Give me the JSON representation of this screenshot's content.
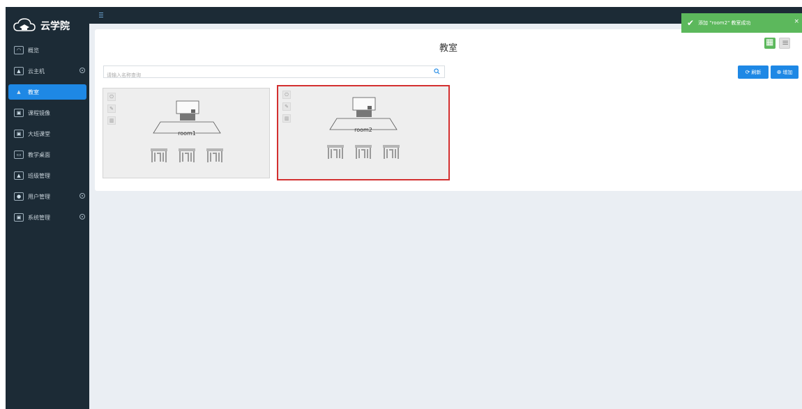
{
  "app": {
    "name": "云学院"
  },
  "sidebar": {
    "items": [
      {
        "label": "概览",
        "icon": "dashboard-icon",
        "glyph": "◠",
        "expandable": false,
        "active": false
      },
      {
        "label": "云主机",
        "icon": "user-icon",
        "glyph": "▲",
        "expandable": true,
        "active": false
      },
      {
        "label": "教室",
        "icon": "classroom-icon",
        "glyph": "▲",
        "expandable": false,
        "active": true
      },
      {
        "label": "课程镜像",
        "icon": "image-icon",
        "glyph": "▣",
        "expandable": false,
        "active": false
      },
      {
        "label": "大班课堂",
        "icon": "lecture-icon",
        "glyph": "▣",
        "expandable": false,
        "active": false
      },
      {
        "label": "教学桌面",
        "icon": "desktop-icon",
        "glyph": "▭",
        "expandable": false,
        "active": false
      },
      {
        "label": "班级管理",
        "icon": "class-management-icon",
        "glyph": "▲",
        "expandable": false,
        "active": false
      },
      {
        "label": "用户管理",
        "icon": "user-management-icon",
        "glyph": "●",
        "expandable": true,
        "active": false
      },
      {
        "label": "系统管理",
        "icon": "system-icon",
        "glyph": "▣",
        "expandable": true,
        "active": false
      }
    ]
  },
  "page": {
    "title": "教室",
    "search_placeholder": "请输入名称查询",
    "refresh_label": "刷新",
    "add_label": "增加"
  },
  "rooms": [
    {
      "name": "room1",
      "selected": false
    },
    {
      "name": "room2",
      "selected": true
    }
  ],
  "toast": {
    "message": "添加 \"room2\" 教室成功",
    "close": "×",
    "color": "#5cb85c"
  },
  "colors": {
    "sidebar": "#1c2b36",
    "accent": "#1e88e5",
    "selection": "#d32f2f"
  }
}
